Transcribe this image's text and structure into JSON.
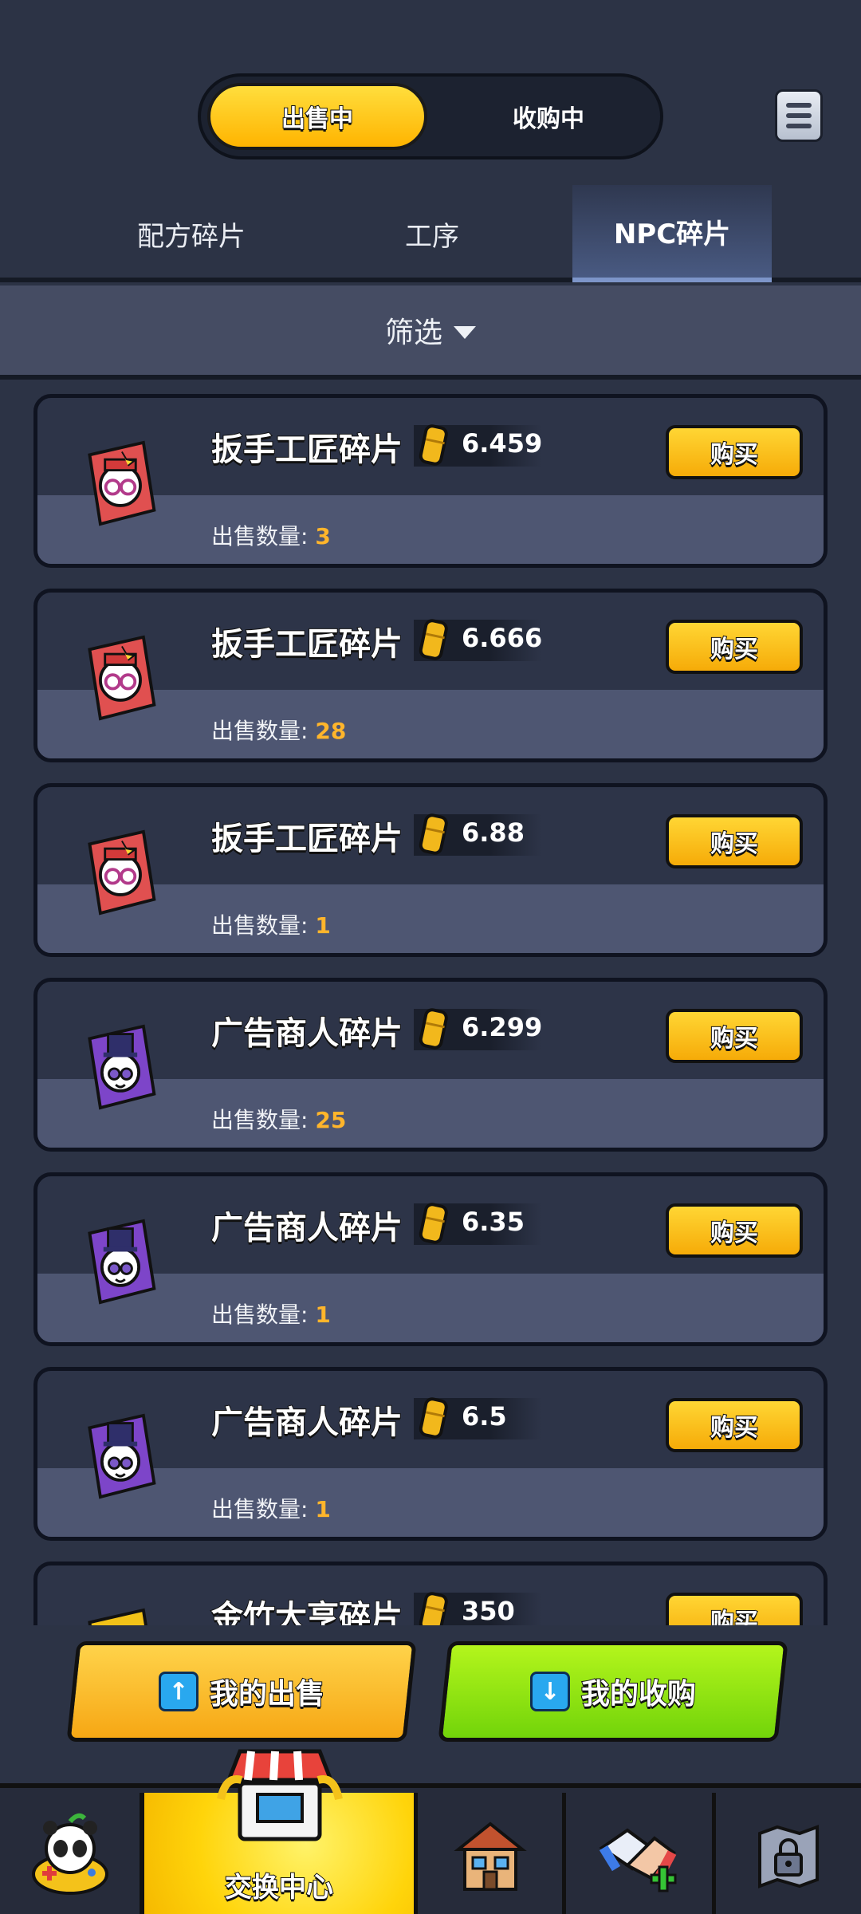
{
  "toggle": {
    "selling": "出售中",
    "buying": "收购中"
  },
  "menu": {
    "icon": "menu-icon"
  },
  "tabs": [
    "配方碎片",
    "工序",
    "NPC碎片"
  ],
  "active_tab": "NPC碎片",
  "filter": {
    "label": "筛选"
  },
  "listing": {
    "buy_label": "购买",
    "qty_label": "出售数量:",
    "items": [
      {
        "name": "扳手工匠碎片",
        "price": "6.459",
        "qty": "3",
        "type": "wrench"
      },
      {
        "name": "扳手工匠碎片",
        "price": "6.666",
        "qty": "28",
        "type": "wrench"
      },
      {
        "name": "扳手工匠碎片",
        "price": "6.88",
        "qty": "1",
        "type": "wrench"
      },
      {
        "name": "广告商人碎片",
        "price": "6.299",
        "qty": "25",
        "type": "ad"
      },
      {
        "name": "广告商人碎片",
        "price": "6.35",
        "qty": "1",
        "type": "ad"
      },
      {
        "name": "广告商人碎片",
        "price": "6.5",
        "qty": "1",
        "type": "ad"
      },
      {
        "name": "金竹大亨碎片",
        "price": "350",
        "qty": "",
        "type": "gold"
      }
    ]
  },
  "actions": {
    "my_sell": "我的出售",
    "my_buy": "我的收购"
  },
  "nav": {
    "exchange": "交换中心"
  },
  "colors": {
    "accent": "#ffb400",
    "green": "#8fe414",
    "bg": "#2c3345"
  }
}
